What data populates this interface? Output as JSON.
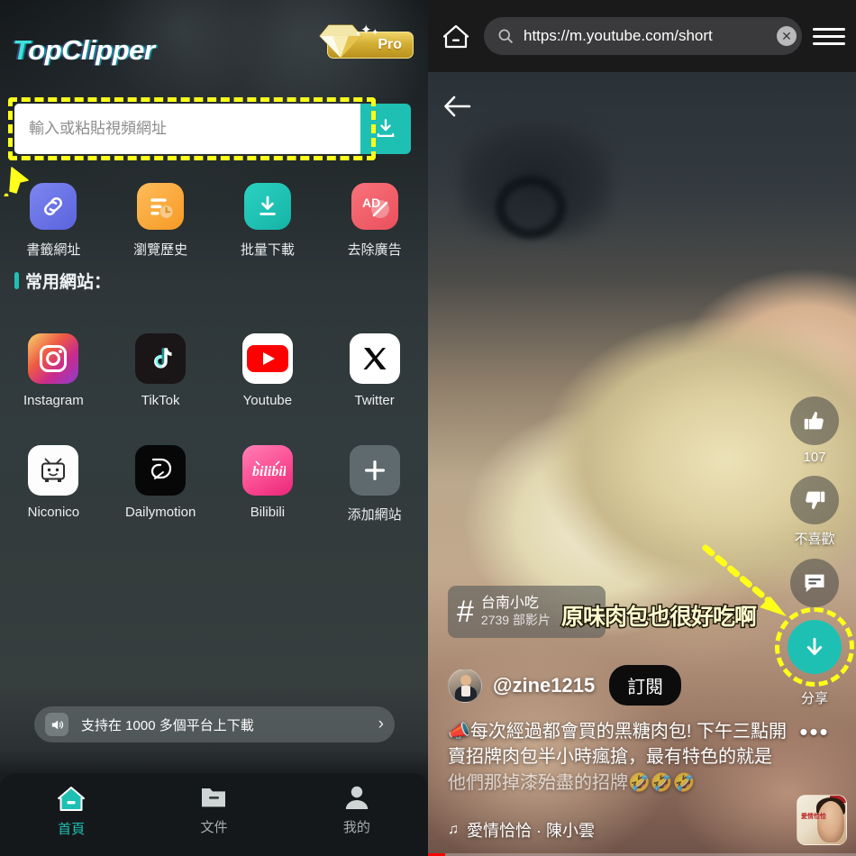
{
  "app": {
    "logo_prefix": "T",
    "logo_rest": "opClipper",
    "pro_label": "Pro",
    "url_placeholder": "輸入或粘貼視頻網址",
    "url_value": "",
    "download_icon": "download-icon",
    "quick_actions": [
      {
        "label": "書籤網址",
        "icon": "link-icon",
        "color": "#6b74e8"
      },
      {
        "label": "瀏覽歷史",
        "icon": "history-icon",
        "color": "#f5a033"
      },
      {
        "label": "批量下載",
        "icon": "batch-download-icon",
        "color": "#1fc0b4"
      },
      {
        "label": "去除廣告",
        "icon": "ad-block-icon",
        "color": "#ef5b62"
      }
    ],
    "section_title": "常用網站：",
    "sites": [
      {
        "label": "Instagram",
        "icon": "instagram-icon"
      },
      {
        "label": "TikTok",
        "icon": "tiktok-icon"
      },
      {
        "label": "Youtube",
        "icon": "youtube-icon"
      },
      {
        "label": "Twitter",
        "icon": "twitter-x-icon"
      },
      {
        "label": "Niconico",
        "icon": "niconico-icon"
      },
      {
        "label": "Dailymotion",
        "icon": "dailymotion-icon"
      },
      {
        "label": "Bilibili",
        "icon": "bilibili-icon"
      },
      {
        "label": "添加網站",
        "icon": "plus-icon"
      }
    ],
    "banner": {
      "text": "支持在 1000 多個平台上下載",
      "speaker_icon": "speaker-icon",
      "chevron": "›"
    },
    "bottom_nav": [
      {
        "label": "首頁",
        "icon": "home-icon",
        "active": true
      },
      {
        "label": "文件",
        "icon": "folder-icon",
        "active": false
      },
      {
        "label": "我的",
        "icon": "person-icon",
        "active": false
      }
    ],
    "accent_color": "#1fc0b4",
    "highlight_color": "#ffff1a"
  },
  "browser": {
    "home_icon": "home-icon",
    "search_icon": "search-icon",
    "url": "https://m.youtube.com/short",
    "clear_icon": "close-icon",
    "menu_icon": "list-menu-icon",
    "back_icon": "back-arrow-icon"
  },
  "shorts": {
    "like_icon": "thumbs-up-icon",
    "like_count": "107",
    "dislike_icon": "thumbs-down-icon",
    "dislike_label": "不喜歡",
    "comment_icon": "comment-icon",
    "share_icon": "download-arrow-icon",
    "share_label": "分享",
    "more_icon": "more-dots-icon",
    "hashtag_symbol": "#",
    "hashtag_name": "台南小吃",
    "hashtag_count": "2739 部影片",
    "burned_subtitle": "原味肉包也很好吃啊",
    "channel": "@zine1215",
    "subscribe_label": "訂閱",
    "caption_line1": "📣每次經過都會買的黑糖肉包! 下午三點開",
    "caption_line2": "賣招牌肉包半小時瘋搶，最有特色的就是",
    "caption_line3": "他們那掉漆殆盡的招牌🤣🤣🤣",
    "music_icon": "music-note-icon",
    "music_text": "愛情恰恰 · 陳小雲",
    "avatar": "channel-avatar",
    "thumbnail": "next-video-thumbnail",
    "thumbnail_title": "愛情恰恰"
  }
}
